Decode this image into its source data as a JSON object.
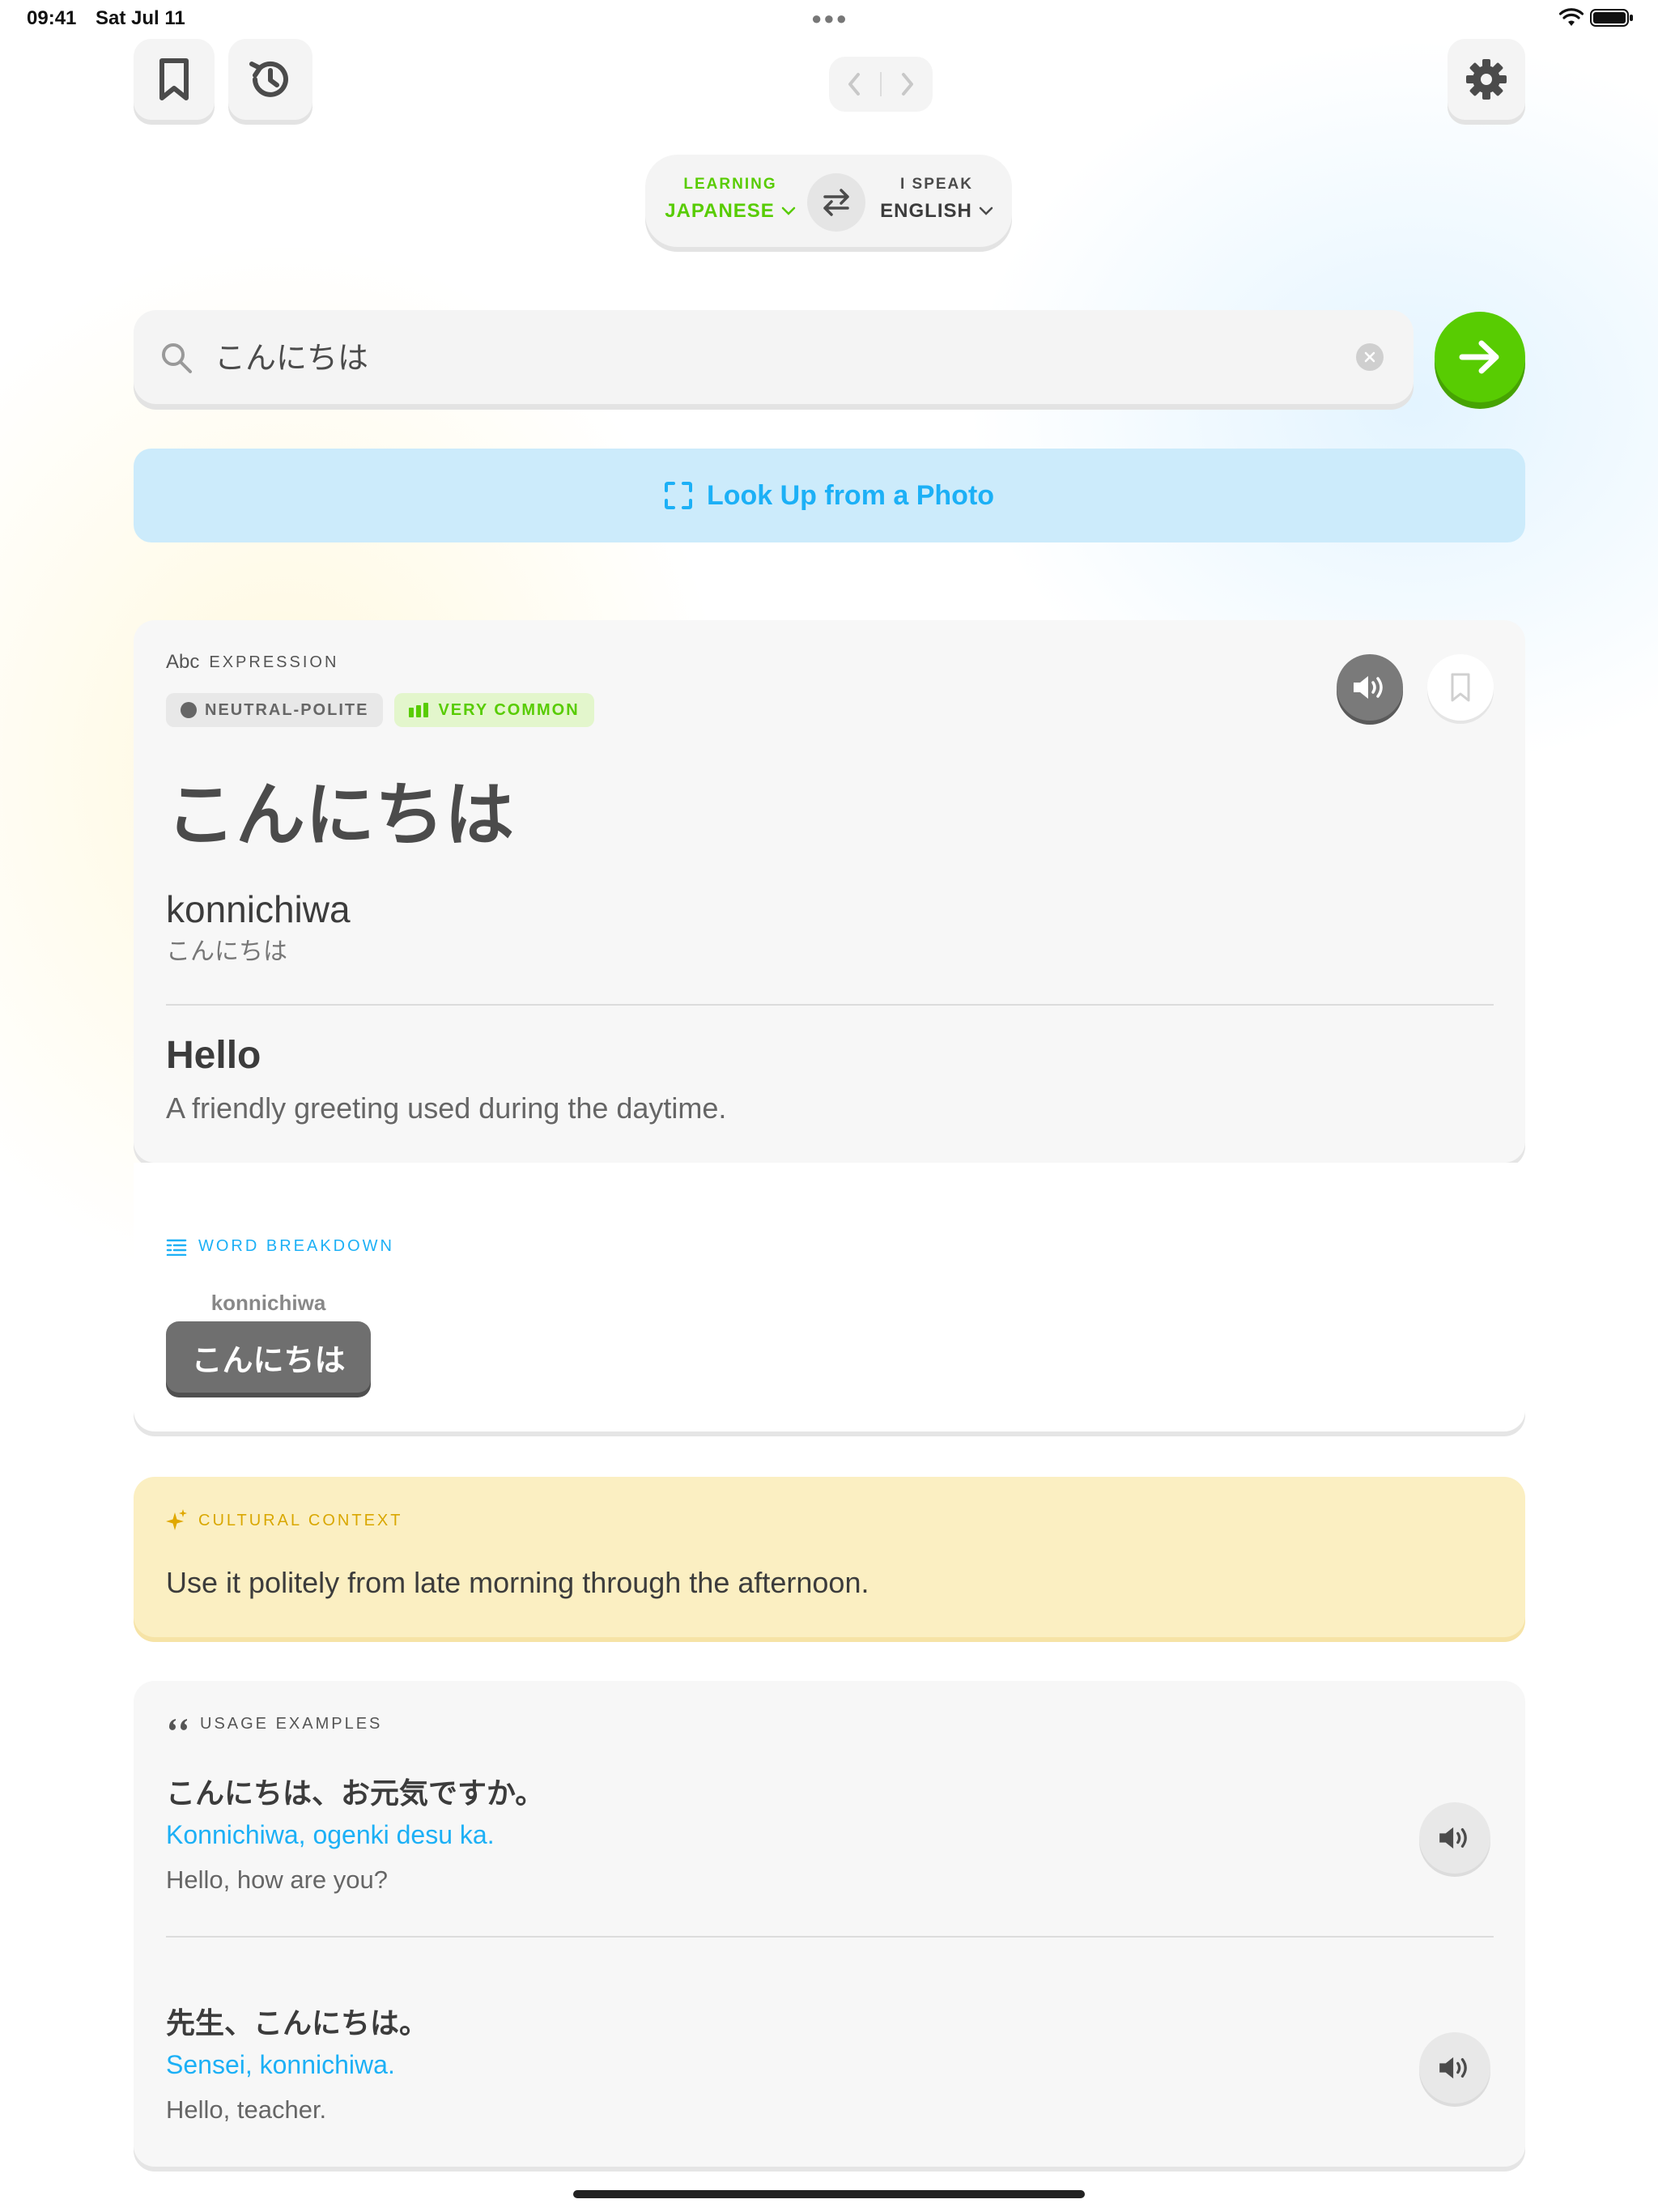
{
  "status_bar": {
    "time": "09:41",
    "date": "Sat Jul 11"
  },
  "header": {
    "nav_prev": "‹",
    "nav_next": "›"
  },
  "language": {
    "learning_label": "LEARNING",
    "learning_value": "JAPANESE",
    "speak_label": "I SPEAK",
    "speak_value": "ENGLISH"
  },
  "search": {
    "value": "こんにちは"
  },
  "photo_lookup": {
    "label": "Look Up from a Photo"
  },
  "entry": {
    "type_icon_text": "Abc",
    "type_label": "EXPRESSION",
    "register": "NEUTRAL-POLITE",
    "frequency": "VERY COMMON",
    "headword": "こんにちは",
    "romaji": "konnichiwa",
    "kana": "こんにちは",
    "meaning": "Hello",
    "definition": "A friendly greeting used during the daytime."
  },
  "breakdown": {
    "label": "WORD BREAKDOWN",
    "chips": [
      {
        "reading": "konnichiwa",
        "text": "こんにちは"
      }
    ]
  },
  "culture": {
    "label": "CULTURAL CONTEXT",
    "text": "Use it politely from late morning through the afternoon."
  },
  "usage": {
    "label": "USAGE EXAMPLES",
    "examples": [
      {
        "jp": "こんにちは、お元気ですか。",
        "romaji": "Konnichiwa, ogenki desu ka.",
        "en": "Hello, how are you?"
      },
      {
        "jp": "先生、こんにちは。",
        "romaji": "Sensei, konnichiwa.",
        "en": "Hello, teacher."
      }
    ]
  },
  "colors": {
    "green": "#58cc02",
    "blue": "#1cb0f6",
    "yellow_label": "#e0a800",
    "text": "#4b4b4b",
    "muted": "#777777"
  }
}
